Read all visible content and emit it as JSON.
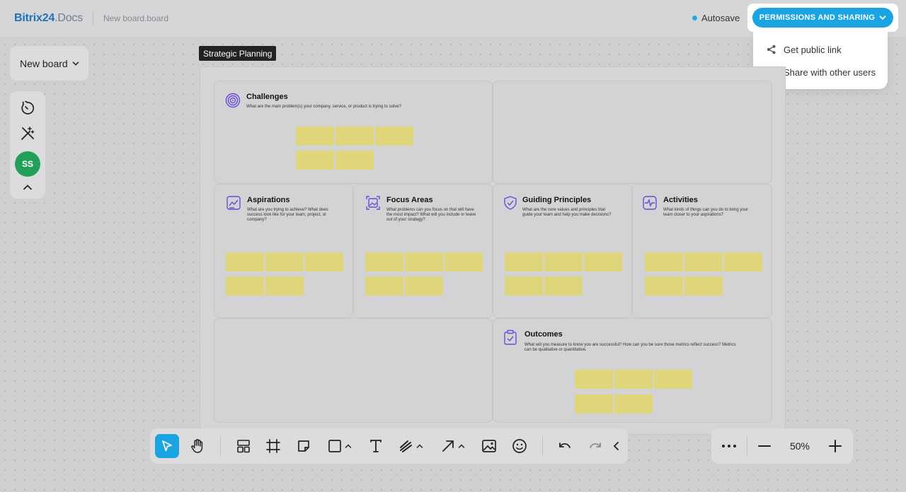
{
  "header": {
    "logo_main": "Bitrix24",
    "logo_suffix": ".Docs",
    "doc_title": "New board.board",
    "autosave_label": "Autosave",
    "permissions_label": "PERMISSIONS AND SHARING"
  },
  "dropdown": {
    "items": [
      {
        "label": "Get public link",
        "icon": "share-icon"
      },
      {
        "label": "Share with other users",
        "icon": "add-user-icon"
      }
    ]
  },
  "left": {
    "board_select_label": "New board",
    "avatar_initials": "SS"
  },
  "board": {
    "frame_label": "Strategic Planning",
    "sections": [
      {
        "title": "Challenges",
        "desc": "What are the main problem(s) your company, service, or product is trying to solve?"
      },
      {
        "title": "Aspirations",
        "desc": "What are you trying to achieve? What does success look like for your team, project, or company?"
      },
      {
        "title": "Focus Areas",
        "desc": "What problems can you focus on that will have the most impact? What will you include or leave out of your strategy?"
      },
      {
        "title": "Guiding Principles",
        "desc": "What are the core values and principles that guide your team and help you make decisions?"
      },
      {
        "title": "Activities",
        "desc": "What kinds of things can you do to bring your team closer to your aspirations?"
      },
      {
        "title": "Outcomes",
        "desc": "What will you measure to know you are successful? How can you be sure those metrics reflect success? Metrics can be qualitative or quantitative."
      }
    ]
  },
  "zoom": {
    "value": "50%"
  },
  "colors": {
    "accent": "#1aa5e2",
    "avatar": "#22a05a",
    "sticky_note": "#dfd57a",
    "icon_purple": "#6a4bd8"
  }
}
